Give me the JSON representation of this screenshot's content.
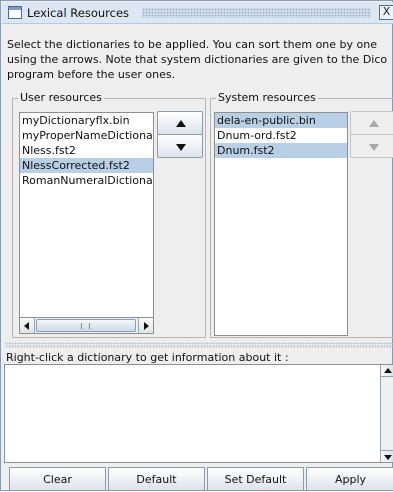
{
  "window": {
    "title": "Lexical Resources",
    "close_glyph": "X"
  },
  "description": "Select the dictionaries to be applied. You can sort them one by one using the arrows. Note that system dictionaries are given to the Dico program before the user ones.",
  "user_resources": {
    "legend": "User resources",
    "items": [
      {
        "label": "myDictionaryflx.bin",
        "selected": false
      },
      {
        "label": "myProperNameDictionary",
        "selected": false
      },
      {
        "label": "Nless.fst2",
        "selected": false
      },
      {
        "label": "NlessCorrected.fst2",
        "selected": true
      },
      {
        "label": "RomanNumeralDictionary",
        "selected": false
      }
    ],
    "up_icon": "triangle-up-icon",
    "down_icon": "triangle-down-icon"
  },
  "system_resources": {
    "legend": "System resources",
    "items": [
      {
        "label": "dela-en-public.bin",
        "selected": true
      },
      {
        "label": "Dnum-ord.fst2",
        "selected": false
      },
      {
        "label": "Dnum.fst2",
        "selected": true
      }
    ],
    "up_icon": "triangle-up-icon",
    "down_icon": "triangle-down-icon"
  },
  "info": {
    "label": "Right-click a dictionary to get information about it :",
    "text": ""
  },
  "buttons": {
    "clear": "Clear",
    "default": "Default",
    "set_default": "Set Default",
    "apply": "Apply"
  },
  "colors": {
    "selection": "#b8cfe5",
    "panel": "#eeeeee",
    "titlebar": "#dde7f3"
  }
}
